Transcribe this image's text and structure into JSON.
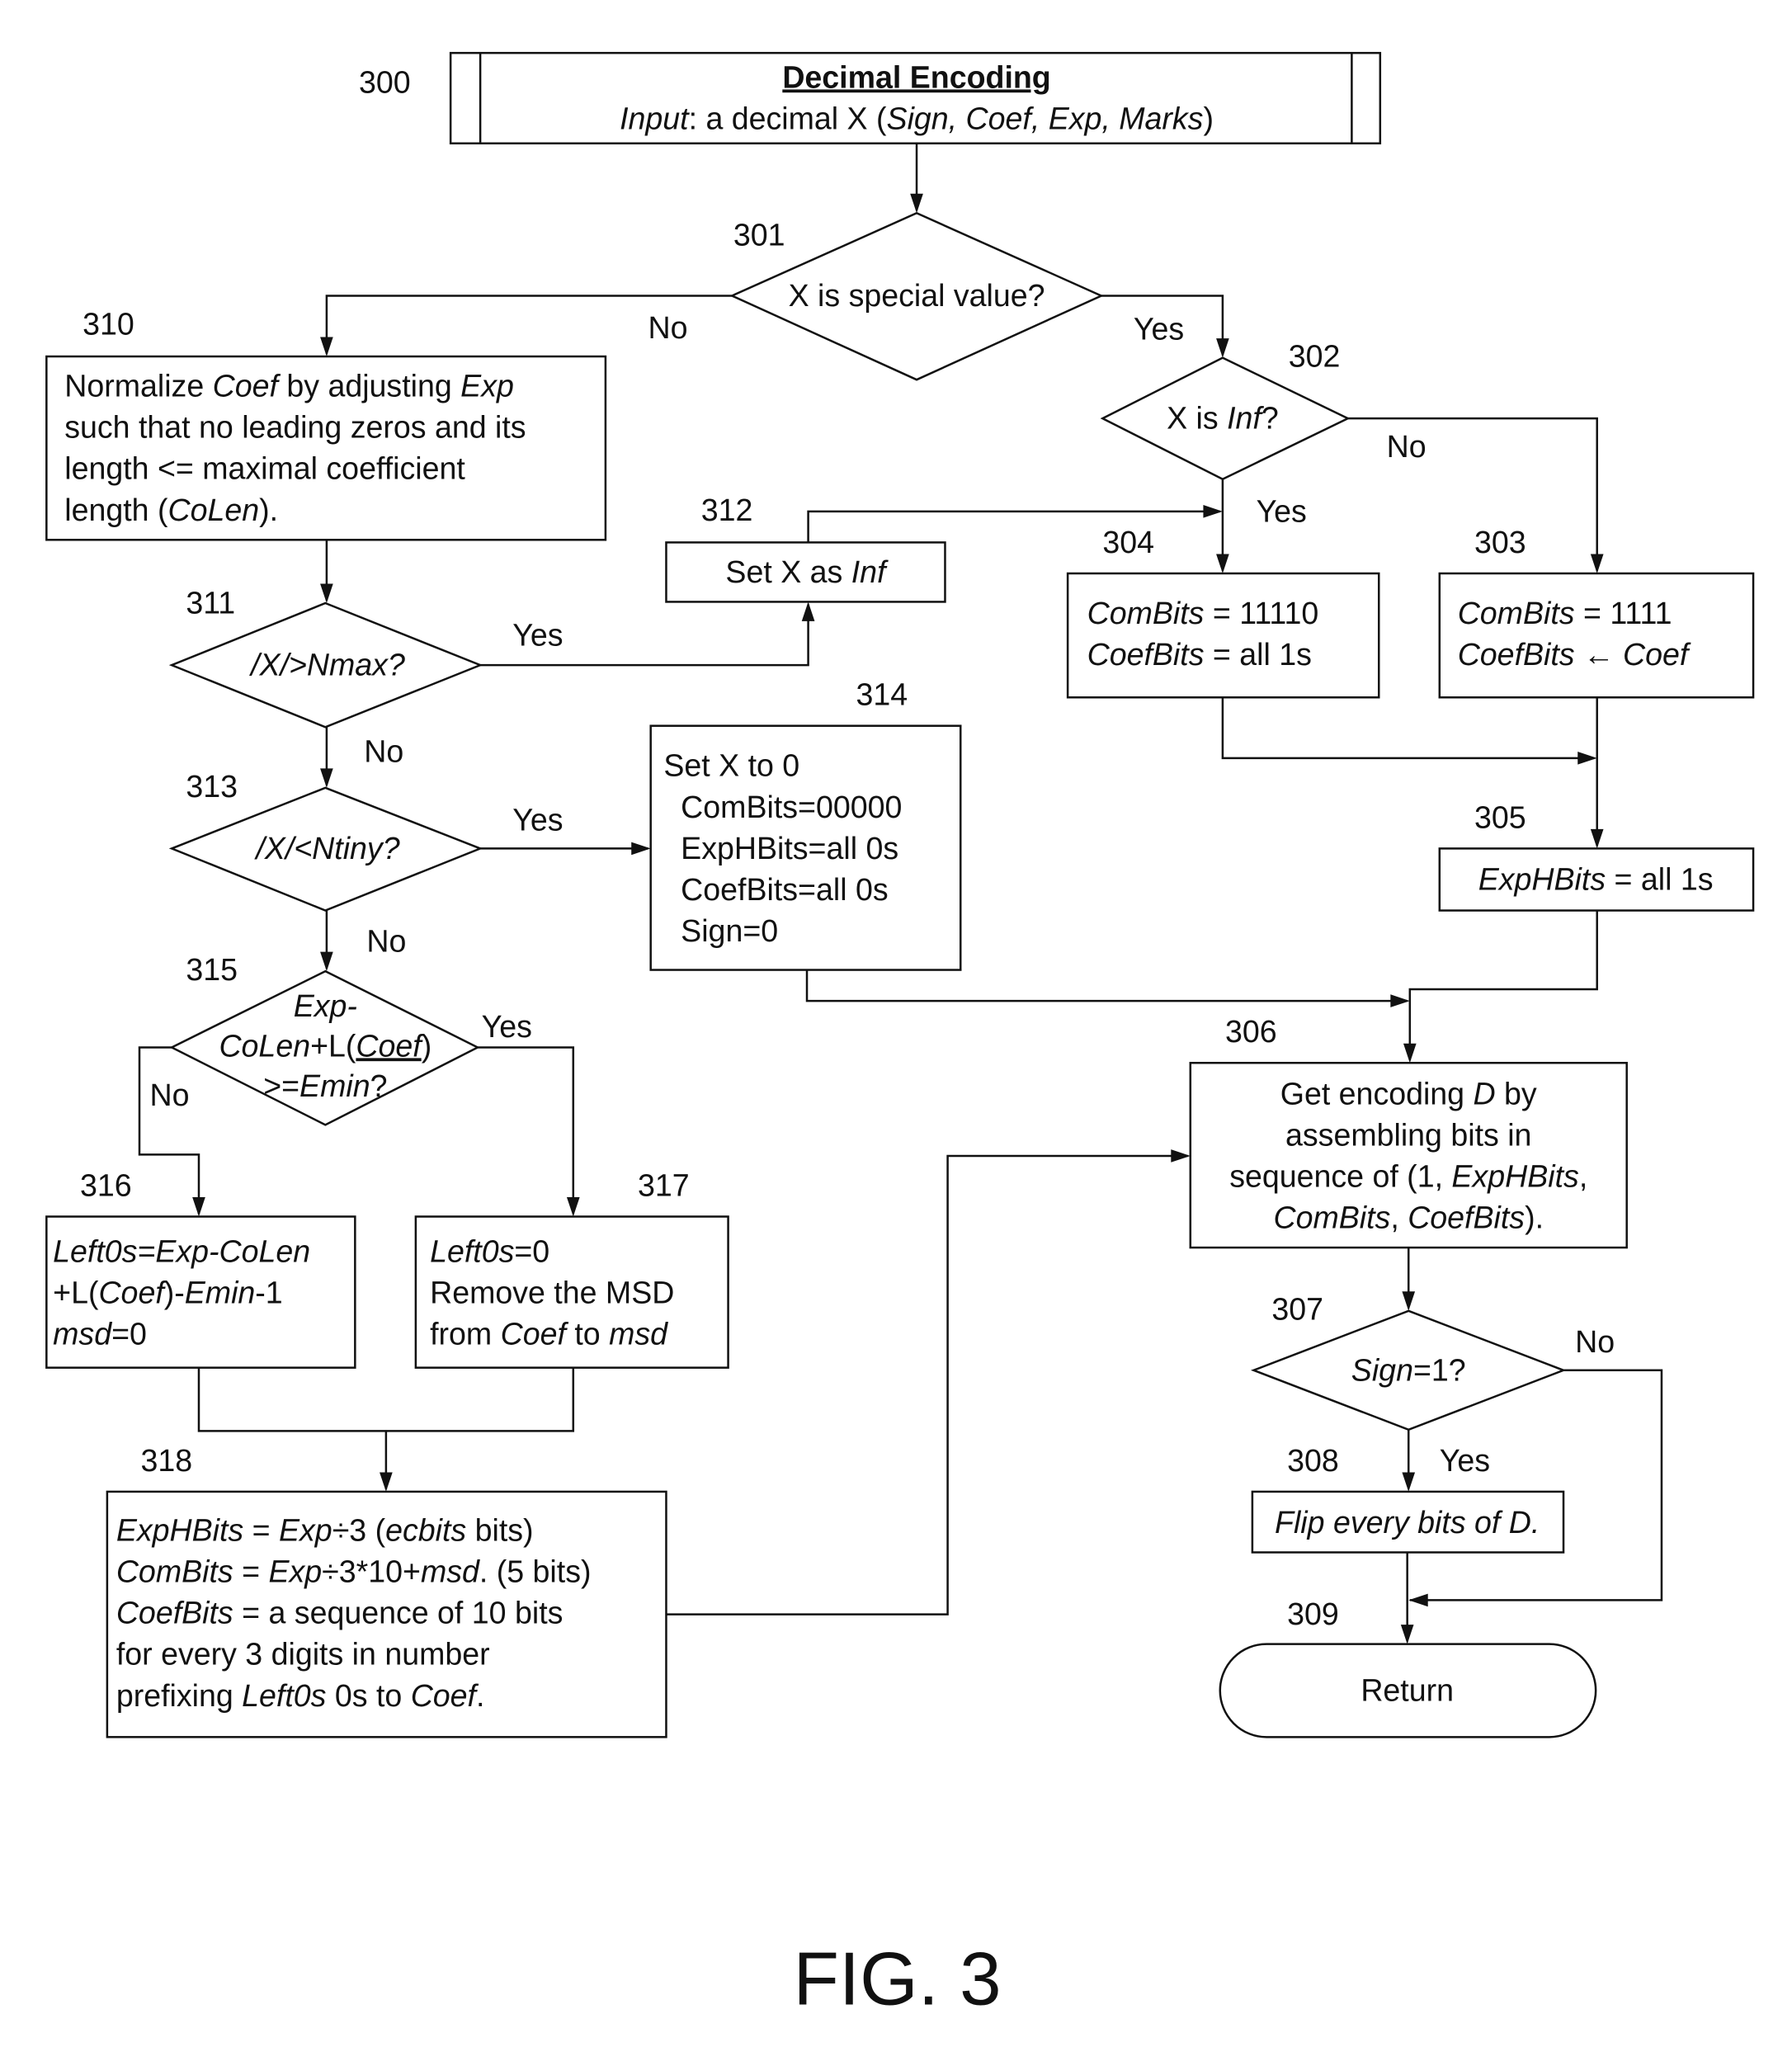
{
  "figure_label": "FIG. 3",
  "colors": {
    "ink": "#111111",
    "background": "#ffffff"
  },
  "nodes": {
    "n300": {
      "ref": "300",
      "type": "predefined-process",
      "title": "Decimal Encoding",
      "lines": [
        [
          {
            "t": "Input",
            "i": true
          },
          {
            "t": ": a decimal X (",
            "i": false
          },
          {
            "t": "Sign, Coef, Exp, Marks",
            "i": true
          },
          {
            "t": ")",
            "i": false
          }
        ]
      ]
    },
    "n301": {
      "ref": "301",
      "type": "decision",
      "lines": [
        [
          {
            "t": "X is special value?",
            "i": false
          }
        ]
      ]
    },
    "n302": {
      "ref": "302",
      "type": "decision",
      "lines": [
        [
          {
            "t": "X is ",
            "i": false
          },
          {
            "t": "Inf",
            "i": true
          },
          {
            "t": "?",
            "i": false
          }
        ]
      ]
    },
    "n303": {
      "ref": "303",
      "type": "process",
      "lines": [
        [
          {
            "t": "ComBits",
            "i": true
          },
          {
            "t": " = 1111",
            "i": false
          }
        ],
        [
          {
            "t": "CoefBits",
            "i": true
          },
          {
            "t": " ← ",
            "i": false
          },
          {
            "t": "Coef",
            "i": true
          }
        ]
      ]
    },
    "n304": {
      "ref": "304",
      "type": "process",
      "lines": [
        [
          {
            "t": "ComBits",
            "i": true
          },
          {
            "t": " = 11110",
            "i": false
          }
        ],
        [
          {
            "t": "CoefBits",
            "i": true
          },
          {
            "t": " = all 1s",
            "i": false
          }
        ]
      ]
    },
    "n305": {
      "ref": "305",
      "type": "process",
      "lines": [
        [
          {
            "t": "ExpHBits",
            "i": true
          },
          {
            "t": " = all 1s",
            "i": false
          }
        ]
      ]
    },
    "n306": {
      "ref": "306",
      "type": "process",
      "lines": [
        [
          {
            "t": "Get encoding ",
            "i": false
          },
          {
            "t": "D",
            "i": true
          },
          {
            "t": " by",
            "i": false
          }
        ],
        [
          {
            "t": "assembling bits in",
            "i": false
          }
        ],
        [
          {
            "t": "sequence of (1, ",
            "i": false
          },
          {
            "t": "ExpHBits",
            "i": true
          },
          {
            "t": ",",
            "i": false
          }
        ],
        [
          {
            "t": "ComBits",
            "i": true
          },
          {
            "t": ", ",
            "i": false
          },
          {
            "t": "CoefBits",
            "i": true
          },
          {
            "t": ").",
            "i": false
          }
        ]
      ]
    },
    "n307": {
      "ref": "307",
      "type": "decision",
      "lines": [
        [
          {
            "t": "Sign",
            "i": true
          },
          {
            "t": "=1?",
            "i": false
          }
        ]
      ]
    },
    "n308": {
      "ref": "308",
      "type": "process",
      "lines": [
        [
          {
            "t": "Flip every bits of D.",
            "i": true
          }
        ]
      ]
    },
    "n309": {
      "ref": "309",
      "type": "terminal",
      "lines": [
        [
          {
            "t": "Return",
            "i": false
          }
        ]
      ]
    },
    "n310": {
      "ref": "310",
      "type": "process",
      "lines": [
        [
          {
            "t": "Normalize ",
            "i": false
          },
          {
            "t": "Coef",
            "i": true
          },
          {
            "t": " by adjusting ",
            "i": false
          },
          {
            "t": "Exp",
            "i": true
          }
        ],
        [
          {
            "t": "such that no leading zeros and its",
            "i": false
          }
        ],
        [
          {
            "t": "length <= maximal coefficient",
            "i": false
          }
        ],
        [
          {
            "t": "length (",
            "i": false
          },
          {
            "t": "CoLen",
            "i": true
          },
          {
            "t": ").",
            "i": false
          }
        ]
      ]
    },
    "n311": {
      "ref": "311",
      "type": "decision",
      "lines": [
        [
          {
            "t": "/X/>Nmax?",
            "i": true
          }
        ]
      ]
    },
    "n312": {
      "ref": "312",
      "type": "process",
      "lines": [
        [
          {
            "t": "Set X as ",
            "i": false
          },
          {
            "t": "Inf",
            "i": true
          }
        ]
      ]
    },
    "n313": {
      "ref": "313",
      "type": "decision",
      "lines": [
        [
          {
            "t": "/X/<Ntiny?",
            "i": true
          }
        ]
      ]
    },
    "n314": {
      "ref": "314",
      "type": "process",
      "lines": [
        [
          {
            "t": "Set X to 0",
            "i": false
          }
        ],
        [
          {
            "t": "  ComBits=00000",
            "i": false
          }
        ],
        [
          {
            "t": "  ExpHBits=all 0s",
            "i": false
          }
        ],
        [
          {
            "t": "  CoefBits=all 0s",
            "i": false
          }
        ],
        [
          {
            "t": "  Sign=0",
            "i": false
          }
        ]
      ]
    },
    "n315": {
      "ref": "315",
      "type": "decision",
      "lines": [
        [
          {
            "t": "Exp-",
            "i": true
          }
        ],
        [
          {
            "t": "CoLen",
            "i": true
          },
          {
            "t": "+L(",
            "i": false
          },
          {
            "t": "Coef",
            "i": true,
            "u": true
          },
          {
            "t": ")",
            "i": false
          }
        ],
        [
          {
            "t": ">=",
            "i": false
          },
          {
            "t": "Emin",
            "i": true
          },
          {
            "t": "?",
            "i": false
          }
        ]
      ]
    },
    "n316": {
      "ref": "316",
      "type": "process",
      "lines": [
        [
          {
            "t": "Left0s=Exp-CoLen",
            "i": true
          }
        ],
        [
          {
            "t": "+L(",
            "i": false
          },
          {
            "t": "Coef",
            "i": true
          },
          {
            "t": ")-",
            "i": false
          },
          {
            "t": "Emin",
            "i": true
          },
          {
            "t": "-1",
            "i": false
          }
        ],
        [
          {
            "t": "msd",
            "i": true
          },
          {
            "t": "=0",
            "i": false
          }
        ]
      ]
    },
    "n317": {
      "ref": "317",
      "type": "process",
      "lines": [
        [
          {
            "t": "Left0s",
            "i": true
          },
          {
            "t": "=0",
            "i": false
          }
        ],
        [
          {
            "t": "Remove the MSD",
            "i": false
          }
        ],
        [
          {
            "t": "from ",
            "i": false
          },
          {
            "t": "Coef",
            "i": true
          },
          {
            "t": " to ",
            "i": false
          },
          {
            "t": "msd",
            "i": true
          }
        ]
      ]
    },
    "n318": {
      "ref": "318",
      "type": "process",
      "lines": [
        [
          {
            "t": "ExpHBits",
            "i": true
          },
          {
            "t": " = ",
            "i": false
          },
          {
            "t": "Exp",
            "i": true
          },
          {
            "t": "÷3 (",
            "i": false
          },
          {
            "t": "ecbits",
            "i": true
          },
          {
            "t": " bits)",
            "i": false
          }
        ],
        [
          {
            "t": "ComBits",
            "i": true
          },
          {
            "t": " = ",
            "i": false
          },
          {
            "t": "Exp",
            "i": true
          },
          {
            "t": "÷3*10+",
            "i": false
          },
          {
            "t": "msd",
            "i": true
          },
          {
            "t": ". (5 bits)",
            "i": false
          }
        ],
        [
          {
            "t": "CoefBits",
            "i": true
          },
          {
            "t": " = a sequence of 10 bits",
            "i": false
          }
        ],
        [
          {
            "t": "for every 3 digits in number",
            "i": false
          }
        ],
        [
          {
            "t": "prefixing ",
            "i": false
          },
          {
            "t": "Left0s",
            "i": true
          },
          {
            "t": " 0s to ",
            "i": false
          },
          {
            "t": "Coef",
            "i": true
          },
          {
            "t": ".",
            "i": false
          }
        ]
      ]
    }
  },
  "edge_labels": {
    "e301_no": "No",
    "e301_yes": "Yes",
    "e302_no": "No",
    "e302_yes": "Yes",
    "e311_yes": "Yes",
    "e311_no": "No",
    "e313_yes": "Yes",
    "e313_no": "No",
    "e315_yes": "Yes",
    "e315_no": "No",
    "e307_no": "No",
    "e307_yes": "Yes"
  },
  "edges": [
    {
      "from": "300",
      "to": "301"
    },
    {
      "from": "301",
      "to": "310",
      "label": "No"
    },
    {
      "from": "301",
      "to": "302",
      "label": "Yes"
    },
    {
      "from": "302",
      "to": "304",
      "label": "Yes"
    },
    {
      "from": "302",
      "to": "303",
      "label": "No"
    },
    {
      "from": "310",
      "to": "311"
    },
    {
      "from": "311",
      "to": "312",
      "label": "Yes"
    },
    {
      "from": "312",
      "to": "304"
    },
    {
      "from": "311",
      "to": "313",
      "label": "No"
    },
    {
      "from": "313",
      "to": "314",
      "label": "Yes"
    },
    {
      "from": "313",
      "to": "315",
      "label": "No"
    },
    {
      "from": "315",
      "to": "317",
      "label": "Yes"
    },
    {
      "from": "315",
      "to": "316",
      "label": "No"
    },
    {
      "from": "316",
      "to": "318"
    },
    {
      "from": "317",
      "to": "318"
    },
    {
      "from": "304",
      "to": "305"
    },
    {
      "from": "303",
      "to": "305"
    },
    {
      "from": "305",
      "to": "306"
    },
    {
      "from": "314",
      "to": "306"
    },
    {
      "from": "318",
      "to": "306"
    },
    {
      "from": "306",
      "to": "307"
    },
    {
      "from": "307",
      "to": "308",
      "label": "Yes"
    },
    {
      "from": "307",
      "to": "309",
      "label": "No"
    },
    {
      "from": "308",
      "to": "309"
    }
  ]
}
